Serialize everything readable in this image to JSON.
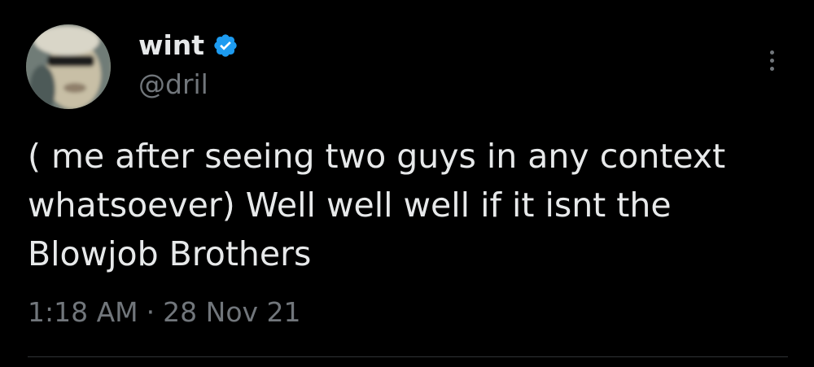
{
  "user": {
    "display_name": "wint",
    "handle": "@dril",
    "verified": true
  },
  "tweet": {
    "lines": [
      "( me after seeing two guys in any context",
      "whatsoever) Well well well if it isnt the",
      "Blowjob Brothers"
    ],
    "time": "1:18 AM",
    "separator": "·",
    "date": "28 Nov 21"
  },
  "icons": {
    "verified": "verified-badge-icon",
    "more": "more-options-icon"
  },
  "colors": {
    "background": "#000000",
    "primary_text": "#e7e9ea",
    "secondary_text": "#71767b",
    "verified_blue": "#1d9bf0",
    "divider": "#2f3336"
  }
}
